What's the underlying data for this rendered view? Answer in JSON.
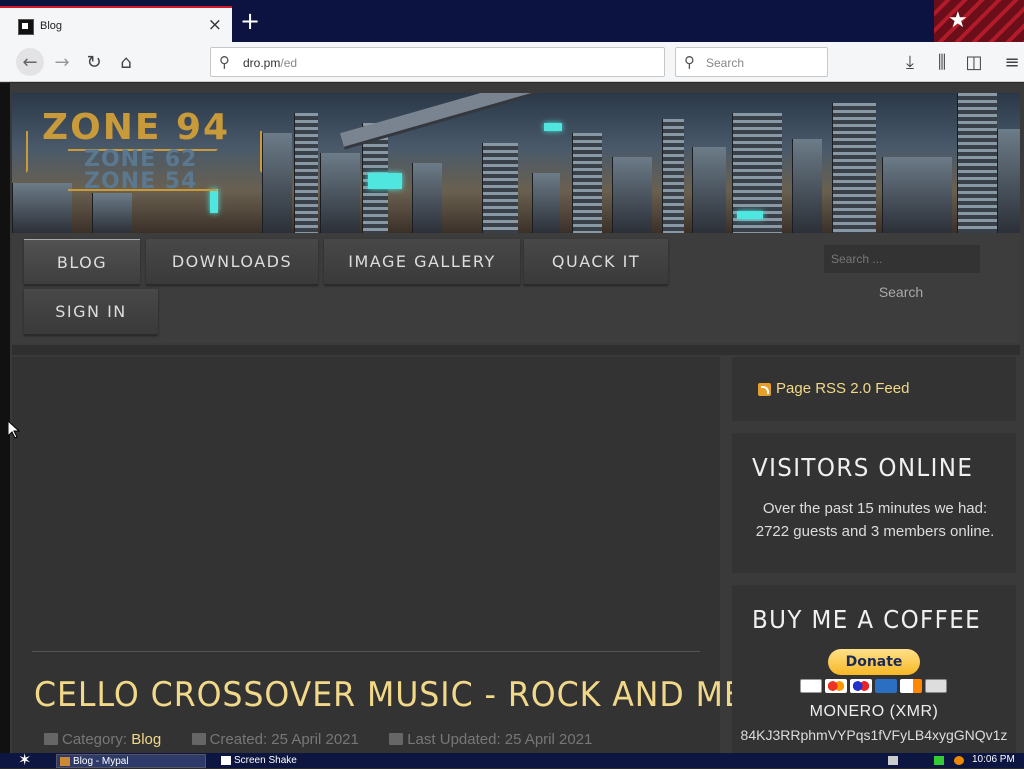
{
  "browser": {
    "tab_title": "Blog",
    "url_host": "dro.pm",
    "url_path": "/ed",
    "search_placeholder": "Search"
  },
  "site": {
    "logo": {
      "main": "ZONE 94",
      "sub1": "ZONE 62",
      "sub2": "ZONE 54"
    },
    "nav": {
      "items": [
        {
          "label": "BLOG"
        },
        {
          "label": "DOWNLOADS"
        },
        {
          "label": "IMAGE GALLERY"
        },
        {
          "label": "QUACK IT"
        },
        {
          "label": "SIGN IN"
        }
      ],
      "search_placeholder": "Search ...",
      "search_button": "Search"
    },
    "post": {
      "title": "CELLO CROSSOVER MUSIC - ROCK AND METAL",
      "category_label": "Category:",
      "category": "Blog",
      "created": "Created: 25 April 2021",
      "updated": "Last Updated: 25 April 2021"
    },
    "sidebar": {
      "rss": "Page RSS 2.0 Feed",
      "visitors": {
        "title": "VISITORS ONLINE",
        "body": "Over the past 15 minutes we had: 2722 guests and 3 members online."
      },
      "coffee": {
        "title": "BUY ME A COFFEE",
        "donate": "Donate",
        "monero_label": "MONERO (XMR)",
        "monero_address": "84KJ3RRphmVYPqs1fVFyLB4xygGNQv1z"
      }
    }
  },
  "taskbar": {
    "task1": "Blog - Mypal",
    "task2": "Screen Shake",
    "clock": "10:06 PM"
  },
  "colors": {
    "accent_gold": "#f2d98a",
    "logo_orange": "#c89a3a",
    "page_bg": "#3a3a3a",
    "tabbar_bg": "#0c1340"
  }
}
